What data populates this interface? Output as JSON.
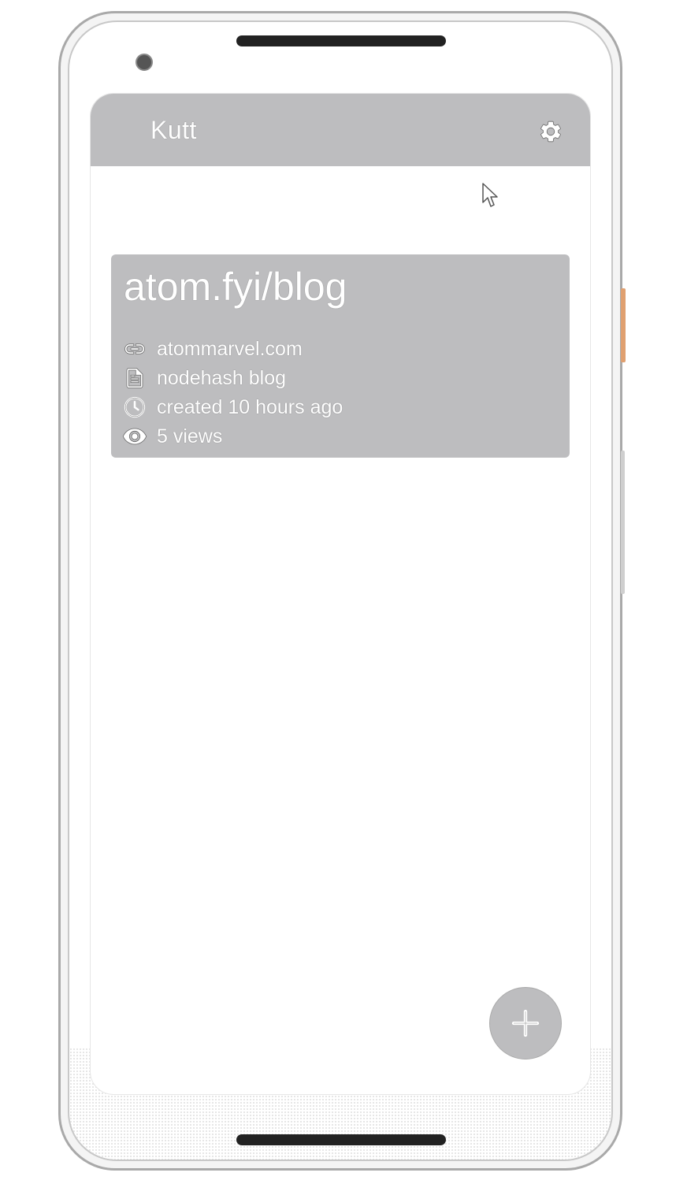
{
  "app_bar": {
    "title": "Kutt",
    "settings_icon": "gear-icon"
  },
  "links": [
    {
      "short_url": "atom.fyi/blog",
      "target": "atommarvel.com",
      "description": "nodehash blog",
      "created": "created 10 hours ago",
      "views": "5 views"
    }
  ],
  "fab": {
    "icon": "plus-icon"
  },
  "colors": {
    "app_bar": "#bdbdbf",
    "card": "#bdbdbf",
    "fab": "#bdbdbf",
    "text_on_surface": "#ffffff"
  }
}
